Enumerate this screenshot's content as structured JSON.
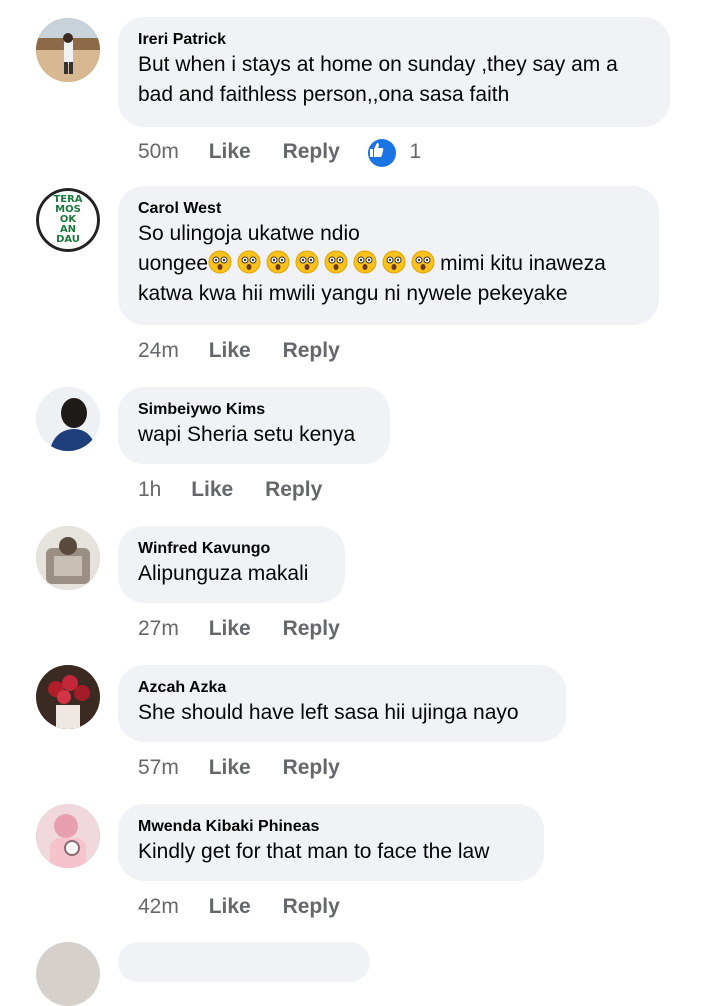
{
  "comments": [
    {
      "name": "Ireri Patrick",
      "lines": [
        "But when i stays at home on sunday ,they say am a",
        "bad and faithless person,,ona sasa faith"
      ],
      "time": "50m",
      "like": "Like",
      "reply": "Reply",
      "reactions": "1"
    },
    {
      "name": "Carol West",
      "line1": "So ulingoja ukatwe ndio",
      "line2_prefix": "uongee",
      "line2_suffix": "mimi kitu inaweza",
      "line3": "katwa kwa hii mwili yangu ni nywele pekeyake",
      "emoji_count": 8,
      "avatar_text": [
        "TERA",
        "MOS",
        "OK",
        "AN",
        "DAU"
      ],
      "time": "24m",
      "like": "Like",
      "reply": "Reply"
    },
    {
      "name": "Simbeiywo Kims",
      "text": "wapi Sheria setu kenya",
      "time": "1h",
      "like": "Like",
      "reply": "Reply"
    },
    {
      "name": "Winfred Kavungo",
      "text": "Alipunguza makali",
      "time": "27m",
      "like": "Like",
      "reply": "Reply"
    },
    {
      "name": "Azcah Azka",
      "text": "She should have left sasa hii ujinga nayo",
      "time": "57m",
      "like": "Like",
      "reply": "Reply"
    },
    {
      "name": "Mwenda Kibaki Phineas",
      "text": "Kindly get for that man to face the law",
      "time": "42m",
      "like": "Like",
      "reply": "Reply"
    }
  ],
  "colors": {
    "bubble": "#f0f2f5",
    "meta": "#65676b",
    "like_blue": "#1b74e4"
  }
}
